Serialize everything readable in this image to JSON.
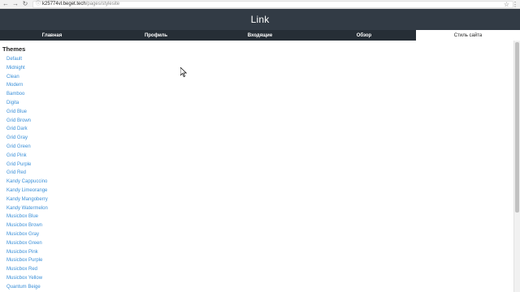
{
  "browser": {
    "url_host": "k25774vl.beget.tech",
    "url_path": "/pages/stylesite"
  },
  "site": {
    "title": "Link"
  },
  "tabs": [
    {
      "label": "Главная",
      "active": false
    },
    {
      "label": "Профиль",
      "active": false
    },
    {
      "label": "Входящие",
      "active": false
    },
    {
      "label": "Обзор",
      "active": false
    },
    {
      "label": "Стиль сайта",
      "active": true
    }
  ],
  "content": {
    "heading": "Themes",
    "themes": [
      "Default",
      "Midnight",
      "Clean",
      "Modern",
      "Bamboo",
      "Digita",
      "Grid Blue",
      "Grid Brown",
      "Grid Dark",
      "Grid Gray",
      "Grid Green",
      "Grid Pink",
      "Grid Purple",
      "Grid Red",
      "Kandy Cappuccino",
      "Kandy Limeorange",
      "Kandy Mangoberry",
      "Kandy Watermelon",
      "Musicbox Blue",
      "Musicbox Brown",
      "Musicbox Gray",
      "Musicbox Green",
      "Musicbox Pink",
      "Musicbox Purple",
      "Musicbox Red",
      "Musicbox Yellow",
      "Quantum Beige"
    ]
  },
  "colors": {
    "header_bg": "#323b45",
    "tabs_bg": "#262e36",
    "link": "#3a8fd8"
  }
}
